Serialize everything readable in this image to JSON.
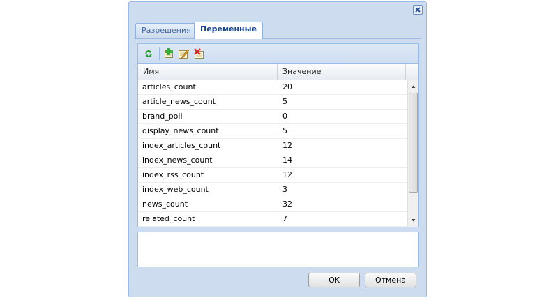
{
  "tabs": [
    {
      "label": "Разрешения",
      "active": false
    },
    {
      "label": "Переменные",
      "active": true
    }
  ],
  "toolbar": {
    "refresh_icon": "refresh-icon",
    "add_icon": "add-icon",
    "edit_icon": "edit-icon",
    "delete_icon": "delete-icon"
  },
  "grid": {
    "columns": [
      "Имя",
      "Значение"
    ],
    "rows": [
      [
        "articles_count",
        "20"
      ],
      [
        "article_news_count",
        "5"
      ],
      [
        "brand_poll",
        "0"
      ],
      [
        "display_news_count",
        "5"
      ],
      [
        "index_articles_count",
        "12"
      ],
      [
        "index_news_count",
        "14"
      ],
      [
        "index_rss_count",
        "12"
      ],
      [
        "index_web_count",
        "3"
      ],
      [
        "news_count",
        "32"
      ],
      [
        "related_count",
        "7"
      ]
    ]
  },
  "buttons": {
    "ok": "OK",
    "cancel": "Отмена"
  },
  "colors": {
    "dialog_bg": "#cddcee",
    "border": "#99bbe8",
    "active_tab_text": "#15428b"
  }
}
